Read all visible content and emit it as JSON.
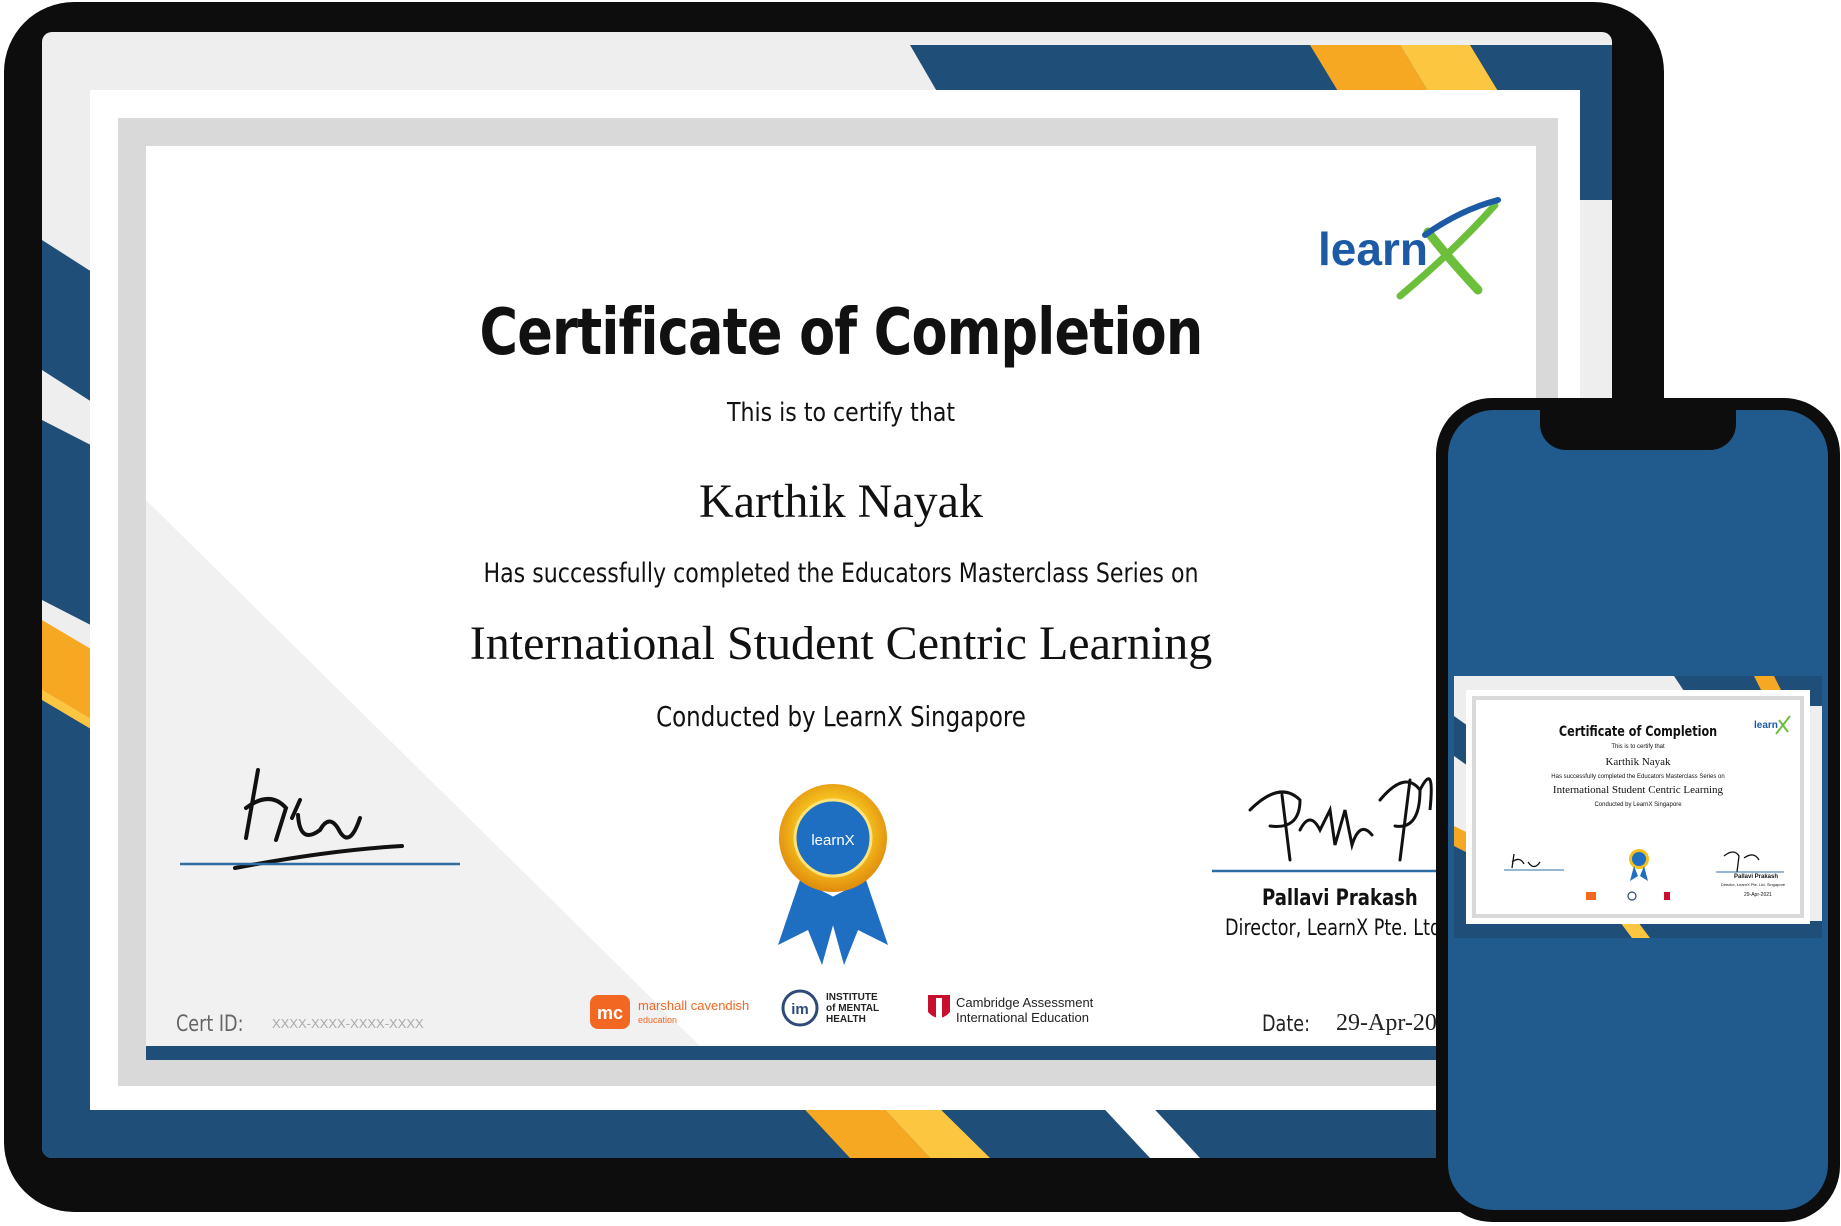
{
  "certificate": {
    "title": "Certificate of Completion",
    "certify_line": "This is to certify that",
    "recipient_name": "Karthik Nayak",
    "completion_line": "Has successfully completed the Educators Masterclass Series on",
    "course_name": "International Student Centric Learning",
    "conducted_by": "Conducted by LearnX Singapore",
    "brand_logo_text": "learn",
    "seal_text": "learnX",
    "signatory_left": {
      "signature_text": "Hiw"
    },
    "signatory_right": {
      "signature_text": "Pallavi P.",
      "name": "Pallavi Prakash",
      "title": "Director, LearnX Pte. Ltd, Sing"
    },
    "cert_id_label": "Cert ID:",
    "cert_id_value": "XXXX-XXXX-XXXX-XXXX",
    "date_label": "Date:",
    "date_value": "29-Apr-20",
    "partners": [
      {
        "mark": "mc",
        "line1": "marshall cavendish",
        "line2": "education"
      },
      {
        "mark": "im",
        "line1": "INSTITUTE",
        "line2": "of MENTAL",
        "line3": "HEALTH"
      },
      {
        "line1": "Cambridge Assessment",
        "line2": "International Education"
      }
    ]
  },
  "phone_certificate": {
    "title": "Certificate of Completion",
    "certify_line": "This is to certify that",
    "recipient_name": "Karthik Nayak",
    "completion_line": "Has successfully completed the Educators Masterclass Series on",
    "course_name": "International Student Centric Learning",
    "conducted_by": "Conducted by LearnX Singapore",
    "signatory_name": "Pallavi Prakash",
    "signatory_title": "Director, LearnX Pte. Ltd, Singapore",
    "date_value": "29-Apr-2021"
  },
  "colors": {
    "navy": "#1f4e79",
    "blue": "#2e6ca4",
    "orange": "#f7a823",
    "yellow": "#fcc640",
    "device": "#111111",
    "phone_screen": "#215a8c",
    "learnx_blue": "#1c5aa6",
    "learnx_green": "#6cbf3b"
  }
}
